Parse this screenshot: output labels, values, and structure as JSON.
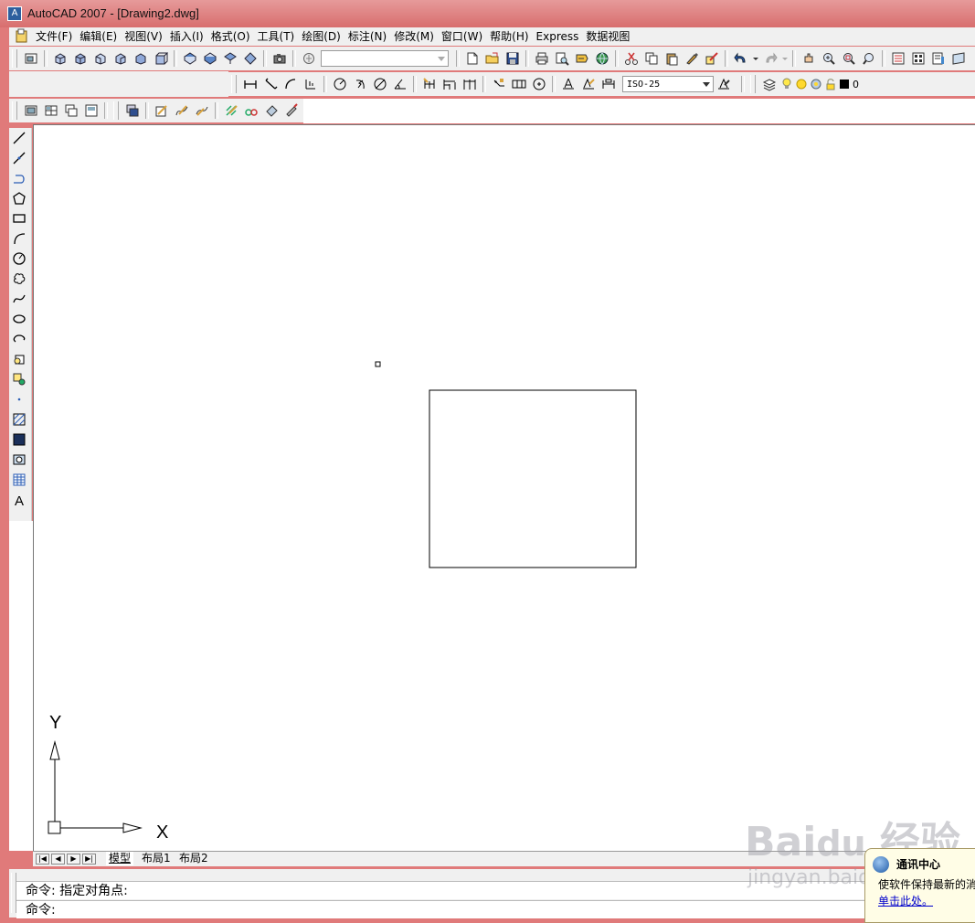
{
  "window": {
    "title": "AutoCAD 2007 - [Drawing2.dwg]"
  },
  "menu": [
    "文件(F)",
    "编辑(E)",
    "视图(V)",
    "插入(I)",
    "格式(O)",
    "工具(T)",
    "绘图(D)",
    "标注(N)",
    "修改(M)",
    "窗口(W)",
    "帮助(H)",
    "Express",
    "数据视图"
  ],
  "toolbar": {
    "view_combo_value": "",
    "dimstyle_value": "ISO-25",
    "layer_value": "0"
  },
  "ucs": {
    "x_label": "X",
    "y_label": "Y"
  },
  "tabs": {
    "model": "模型",
    "layout1": "布局1",
    "layout2": "布局2"
  },
  "command": {
    "line1": "命令: 指定对角点:",
    "line2": "命令:"
  },
  "notification": {
    "title": "通讯中心",
    "body": "使软件保持最新的消",
    "link": "单击此处。"
  },
  "watermark": {
    "logo": "Bai du 经验",
    "url": "jingyan.baidu.com"
  },
  "colors": {
    "titlebar": "#d86e6e",
    "chrome": "#f0f0f0",
    "canvas": "#ffffff",
    "link": "#0000cc"
  }
}
